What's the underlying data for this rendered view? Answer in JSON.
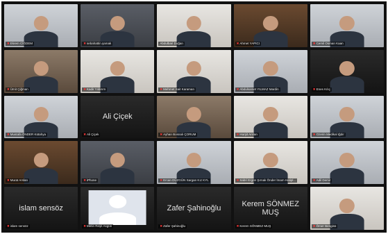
{
  "participants": [
    {
      "name": "Ekrem CİĞDEM",
      "center": "",
      "bg": "bg-light",
      "active": false,
      "muted": true
    },
    {
      "name": "sebahattin.şamak",
      "center": "",
      "bg": "bg-office",
      "active": false,
      "muted": true
    },
    {
      "name": "Abdulbari Doğan",
      "center": "",
      "bg": "bg-white",
      "active": true,
      "muted": false
    },
    {
      "name": "Ahmet YAPICI",
      "center": "",
      "bg": "bg-shelf",
      "active": false,
      "muted": true
    },
    {
      "name": "Cemil Osman Kaan",
      "center": "",
      "bg": "bg-light",
      "active": false,
      "muted": true
    },
    {
      "name": "Ümit Çiğman",
      "center": "",
      "bg": "bg-warm",
      "active": false,
      "muted": true
    },
    {
      "name": "Kadir Yıldırım",
      "center": "",
      "bg": "bg-white",
      "active": false,
      "muted": true
    },
    {
      "name": "Mehmet Sait Karaman",
      "center": "",
      "bg": "bg-white",
      "active": false,
      "muted": true
    },
    {
      "name": "Abdulsamet YILMAZ Mardin",
      "center": "",
      "bg": "bg-light",
      "active": false,
      "muted": true
    },
    {
      "name": "Enes Kılıç",
      "center": "",
      "bg": "bg-dark",
      "active": false,
      "muted": true
    },
    {
      "name": "Mustafa ÖNDER Kütahya",
      "center": "",
      "bg": "bg-light",
      "active": false,
      "muted": true
    },
    {
      "name": "Ali Çiçek",
      "center": "Ali Çiçek",
      "bg": "bg-dark",
      "active": false,
      "muted": true
    },
    {
      "name": "Ayhan Bosnalı ÇORUM",
      "center": "",
      "bg": "bg-warm",
      "active": false,
      "muted": true
    },
    {
      "name": "Hurşit Arslan",
      "center": "",
      "bg": "bg-white",
      "active": false,
      "muted": true
    },
    {
      "name": "Ozerin Medikal Iğdır",
      "center": "",
      "bg": "bg-light",
      "active": false,
      "muted": true
    },
    {
      "name": "Murat Arslan",
      "center": "",
      "bg": "bg-shelf",
      "active": false,
      "muted": true
    },
    {
      "name": "iPhone",
      "center": "",
      "bg": "bg-office",
      "active": false,
      "muted": true
    },
    {
      "name": "Ercan DÜZGÜN Sargan Kız KYL",
      "center": "",
      "bg": "bg-light",
      "active": false,
      "muted": true
    },
    {
      "name": "Sabri Ergün Şırnak Önder İmam Hatipl...",
      "center": "",
      "bg": "bg-white",
      "active": false,
      "muted": true
    },
    {
      "name": "Adil Demir",
      "center": "",
      "bg": "bg-light",
      "active": false,
      "muted": true
    },
    {
      "name": "islam sensöz",
      "center": "islam sensöz",
      "bg": "bg-dark",
      "active": false,
      "muted": true
    },
    {
      "name": "Metin Reşit Asgün",
      "center": "",
      "bg": "bg-dark",
      "active": false,
      "muted": true,
      "placeholder": true
    },
    {
      "name": "Zafer Şahinoğlu",
      "center": "Zafer Şahinoğlu",
      "bg": "bg-dark",
      "active": false,
      "muted": true
    },
    {
      "name": "Kerem SÖNMEZ MUŞ",
      "center": "Kerem SÖNMEZ MUŞ",
      "bg": "bg-dark",
      "active": false,
      "muted": true
    },
    {
      "name": "Ömer Bengisü",
      "center": "",
      "bg": "bg-white",
      "active": false,
      "muted": true
    }
  ],
  "icons": {
    "muted": "microphone-muted-icon"
  },
  "colors": {
    "active_border": "#3fbf3f",
    "mute": "#ff3b3b",
    "grid_bg": "#111111"
  }
}
